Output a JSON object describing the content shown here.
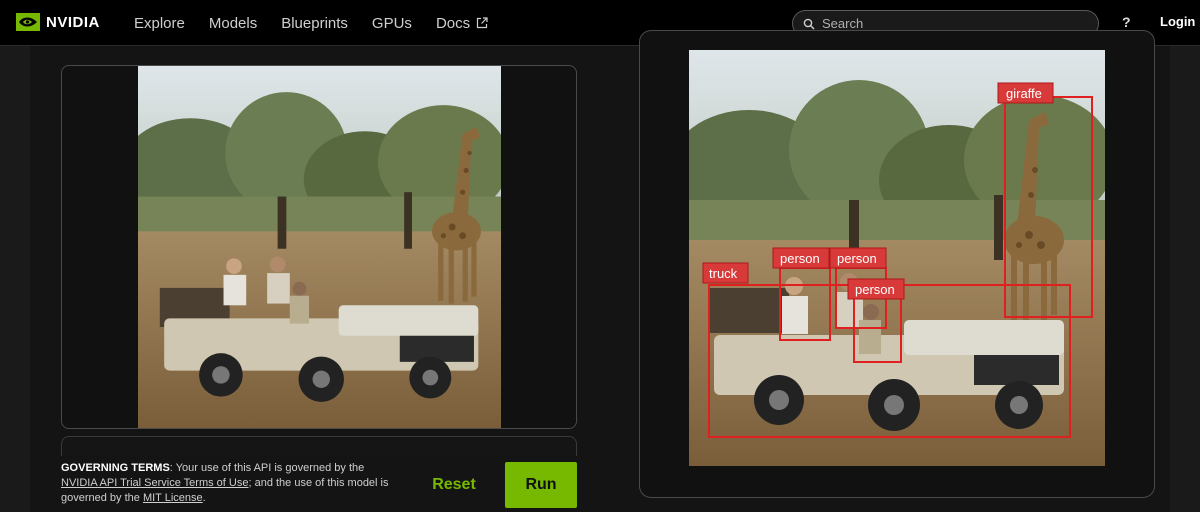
{
  "brand": {
    "name": "NVIDIA"
  },
  "nav": {
    "items": [
      {
        "label": "Explore"
      },
      {
        "label": "Models"
      },
      {
        "label": "Blueprints"
      },
      {
        "label": "GPUs"
      },
      {
        "label": "Docs"
      }
    ]
  },
  "search": {
    "placeholder": "Search",
    "value": ""
  },
  "header": {
    "help_label": "?",
    "login_label": "Login"
  },
  "terms": {
    "heading": "GOVERNING TERMS",
    "text_1": ": Your use of this API is governed by the ",
    "link_1": "NVIDIA API Trial Service Terms of Use",
    "text_2": "; and the use of this model is governed by the ",
    "link_2": "MIT License",
    "text_3": "."
  },
  "actions": {
    "reset_label": "Reset",
    "run_label": "Run"
  },
  "detections": [
    {
      "label": "giraffe"
    },
    {
      "label": "truck"
    },
    {
      "label": "person"
    },
    {
      "label": "person"
    },
    {
      "label": "person"
    }
  ],
  "colors": {
    "accent": "#76b900",
    "detection_box": "#e02020",
    "background": "#1a1a1a"
  }
}
